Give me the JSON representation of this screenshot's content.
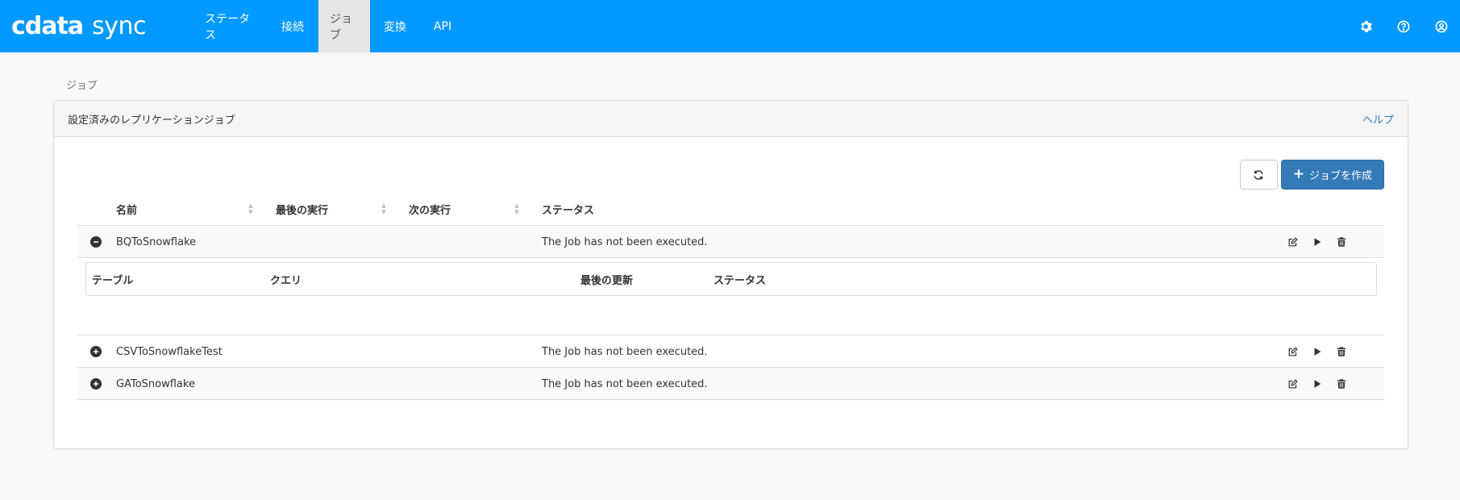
{
  "brand": {
    "logo": "cdata",
    "product": "sync"
  },
  "nav": {
    "items": [
      {
        "label": "ステータス",
        "active": false
      },
      {
        "label": "接続",
        "active": false
      },
      {
        "label": "ジョブ",
        "active": true
      },
      {
        "label": "変換",
        "active": false
      },
      {
        "label": "API",
        "active": false
      }
    ],
    "icons": [
      "gear-icon",
      "help-circle-icon",
      "user-circle-icon"
    ]
  },
  "breadcrumb": "ジョブ",
  "panel": {
    "title": "設定済みのレプリケーションジョブ",
    "help": "ヘルプ",
    "create_button": "ジョブを作成",
    "refresh_icon": "refresh-icon"
  },
  "table": {
    "headers": {
      "name": "名前",
      "last_run": "最後の実行",
      "next_run": "次の実行",
      "status": "ステータス"
    },
    "rows": [
      {
        "name": "BQToSnowflake",
        "last_run": "",
        "next_run": "",
        "status": "The Job has not been executed.",
        "expanded": true
      },
      {
        "name": "CSVToSnowflakeTest",
        "last_run": "",
        "next_run": "",
        "status": "The Job has not been executed.",
        "expanded": false
      },
      {
        "name": "GAToSnowflake",
        "last_run": "",
        "next_run": "",
        "status": "The Job has not been executed.",
        "expanded": false
      }
    ],
    "subtable_headers": {
      "table": "テーブル",
      "query": "クエリ",
      "last_updated": "最後の更新",
      "status": "ステータス"
    }
  },
  "colors": {
    "navbar": "#0099ff",
    "primary_button": "#337ab7",
    "help_link": "#337ab7"
  }
}
